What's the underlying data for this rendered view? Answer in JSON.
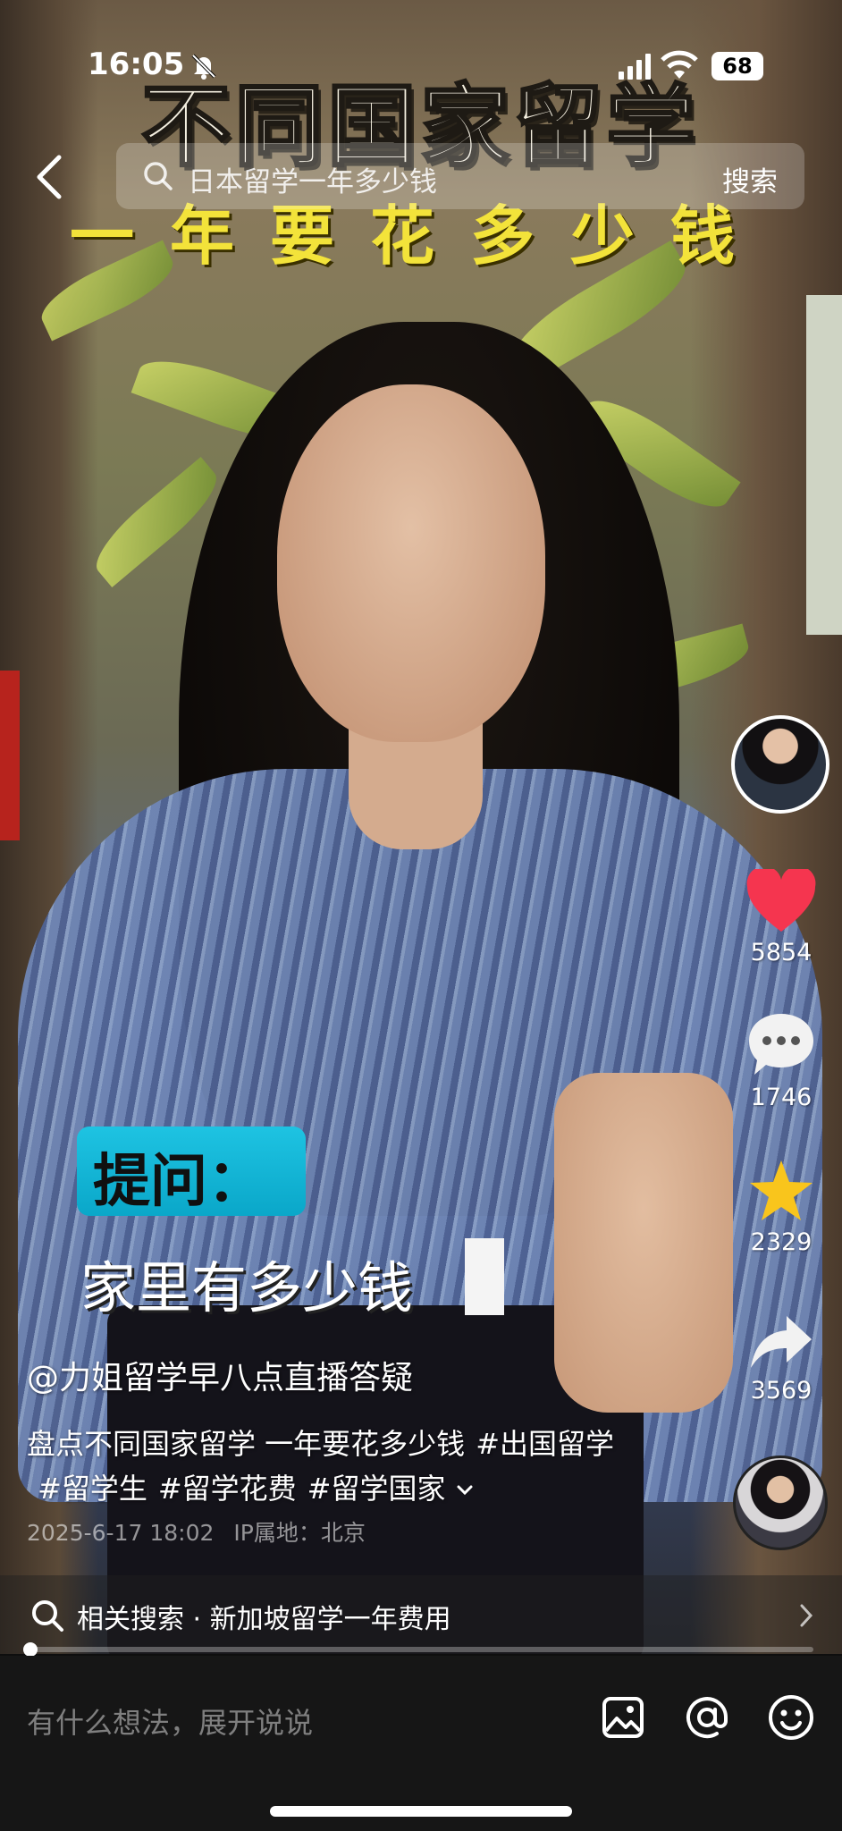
{
  "status_bar": {
    "time": "16:05",
    "battery": "68"
  },
  "overlay_title": {
    "line1": "不同国家留学",
    "line2": "一年要花多少钱"
  },
  "search": {
    "query": "日本留学一年多少钱",
    "button": "搜索"
  },
  "video_subtitle": {
    "tag": "提问：",
    "text": "家里有多少钱"
  },
  "actions": {
    "likes": "5854",
    "comments": "1746",
    "favorites": "2329",
    "shares": "3569"
  },
  "post": {
    "author": "@力姐留学早八点直播答疑",
    "description": "盘点不同国家留学 一年要花多少钱",
    "hashtags": [
      "#出国留学",
      "#留学生",
      "#留学花费",
      "#留学国家"
    ],
    "date": "2025-6-17 18:02",
    "location": "IP属地：北京"
  },
  "related_search": {
    "label": "相关搜索 · 新加坡留学一年费用"
  },
  "progress": {
    "fraction": 0.005
  },
  "comment_bar": {
    "placeholder": "有什么想法，展开说说"
  },
  "colors": {
    "like": "#f5354f",
    "favorite": "#f9c51c",
    "question_tag": "#12b6d6",
    "title_yellow": "#f3e33a"
  },
  "icons": [
    "bell-off-icon",
    "signal-icon",
    "wifi-icon",
    "back-icon",
    "search-icon",
    "heart-icon",
    "comment-icon",
    "star-icon",
    "share-icon",
    "chevron-down-icon",
    "chevron-right-icon",
    "image-icon",
    "at-icon",
    "emoji-icon"
  ]
}
